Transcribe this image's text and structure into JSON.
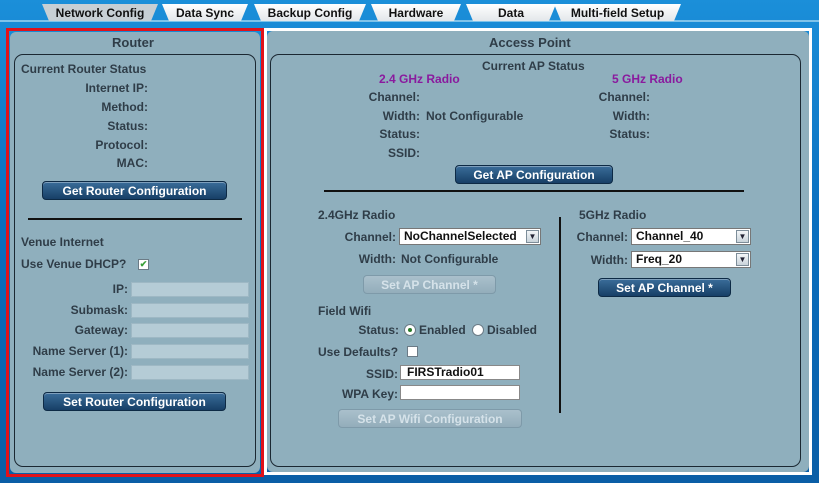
{
  "tabs": [
    {
      "label": "Network Config",
      "active": true
    },
    {
      "label": "Data Sync"
    },
    {
      "label": "Backup Config"
    },
    {
      "label": "Hardware"
    },
    {
      "label": "Data"
    },
    {
      "label": "Multi-field Setup"
    }
  ],
  "router": {
    "title": "Router",
    "status_heading": "Current Router Status",
    "fields": {
      "internet_ip": "Internet IP:",
      "method": "Method:",
      "status": "Status:",
      "protocol": "Protocol:",
      "mac": "MAC:"
    },
    "get_button": "Get Router Configuration",
    "venue_heading": "Venue Internet",
    "use_dhcp_label": "Use Venue DHCP?",
    "use_dhcp_checked": true,
    "ip_label": "IP:",
    "submask_label": "Submask:",
    "gateway_label": "Gateway:",
    "ns1_label": "Name Server (1):",
    "ns2_label": "Name Server (2):",
    "ip_value": "",
    "submask_value": "",
    "gateway_value": "",
    "ns1_value": "",
    "ns2_value": "",
    "set_button": "Set Router Configuration"
  },
  "ap": {
    "title": "Access Point",
    "status_heading": "Current AP Status",
    "radio24_heading": "2.4 GHz Radio",
    "radio5_heading": "5 GHz Radio",
    "channel_label": "Channel:",
    "width_label": "Width:",
    "status_label": "Status:",
    "ssid_label": "SSID:",
    "width24_value": "Not Configurable",
    "get_button": "Get AP Configuration",
    "cfg24": {
      "heading": "2.4GHz Radio",
      "channel_label": "Channel:",
      "channel_value": "NoChannelSelected",
      "width_label": "Width:",
      "width_value": "Not Configurable",
      "set_button": "Set AP Channel *"
    },
    "cfg5": {
      "heading": "5GHz Radio",
      "channel_label": "Channel:",
      "channel_value": "Channel_40",
      "width_label": "Width:",
      "width_value": "Freq_20",
      "set_button": "Set AP Channel *"
    },
    "wifi": {
      "heading": "Field Wifi",
      "status_label": "Status:",
      "enabled_label": "Enabled",
      "disabled_label": "Disabled",
      "status_selected": "Enabled",
      "defaults_label": "Use Defaults?",
      "defaults_checked": false,
      "ssid_label": "SSID:",
      "ssid_value": "FIRSTradio01",
      "wpa_label": "WPA Key:",
      "wpa_value": "",
      "set_button": "Set AP Wifi Configuration"
    }
  },
  "colors": {
    "background": "#0a6fbf",
    "panel": "#8fafbd",
    "highlight_left": "#e0121a",
    "highlight_right": "#ffffff",
    "radio_heading": "#8a1a9e"
  }
}
